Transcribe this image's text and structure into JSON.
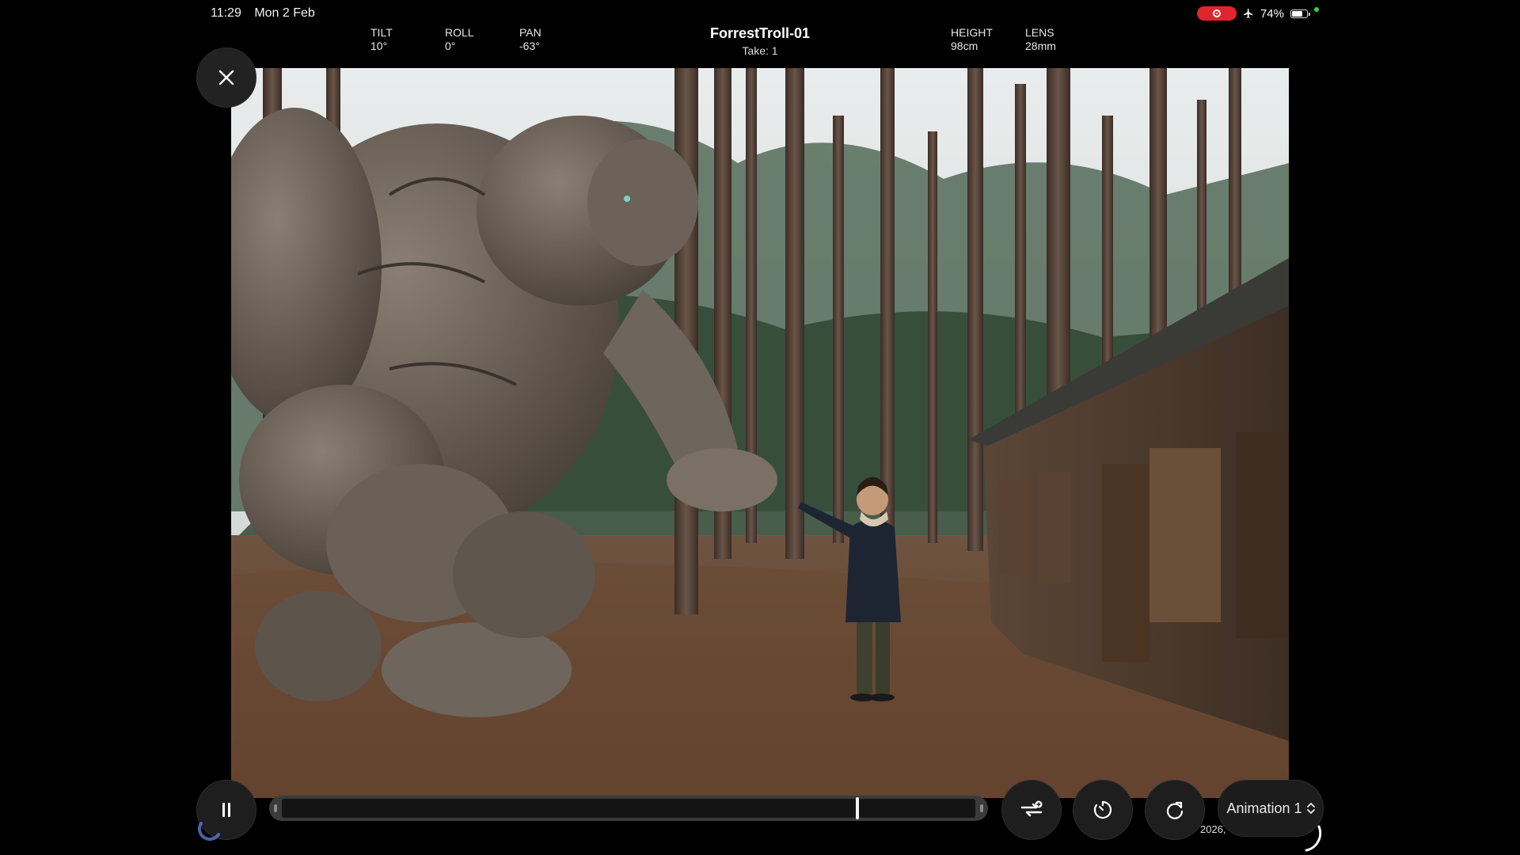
{
  "status_bar": {
    "time": "11:29",
    "date": "Mon 2 Feb",
    "battery_percent": "74%",
    "battery_level": 0.74,
    "recording": true,
    "airplane_mode": true,
    "colors": {
      "record": "#e0252d",
      "mic_dot": "#33d04a"
    }
  },
  "camera": {
    "tilt": {
      "label": "TILT",
      "value": "10°"
    },
    "roll": {
      "label": "ROLL",
      "value": "0°"
    },
    "pan": {
      "label": "PAN",
      "value": "-63°"
    },
    "height": {
      "label": "HEIGHT",
      "value": "98cm"
    },
    "lens": {
      "label": "LENS",
      "value": "28mm"
    }
  },
  "shot": {
    "title": "ForrestTroll-01",
    "take": "Take: 1"
  },
  "controls": {
    "close_icon": "close-icon",
    "pause_icon": "pause-icon",
    "swap_icon": "swap-add-icon",
    "timer_icon": "timer-icon",
    "redo_icon": "rotate-icon",
    "animation_label": "Animation 1",
    "date_fragment": "2026,",
    "timeline_position": 0.83
  }
}
